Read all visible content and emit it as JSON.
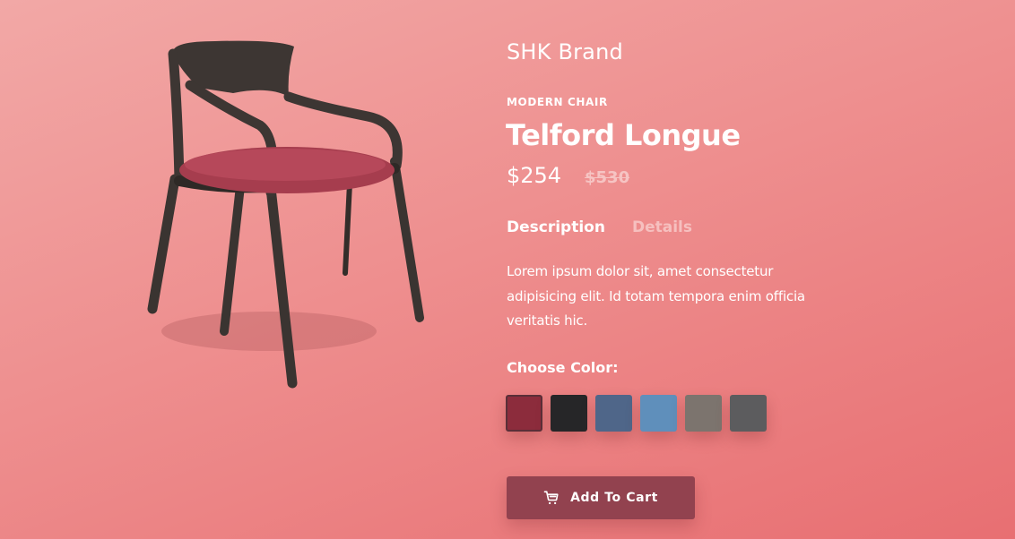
{
  "product": {
    "brand": "SHK Brand",
    "category": "MODERN CHAIR",
    "title": "Telford Longue",
    "price": "$254",
    "old_price": "$530"
  },
  "tabs": [
    {
      "label": "Description",
      "active": true
    },
    {
      "label": "Details",
      "active": false
    }
  ],
  "description": "Lorem ipsum dolor sit, amet consectetur adipisicing elit. Id totam tempora enim officia veritatis hic.",
  "colors": {
    "label": "Choose Color:",
    "options": [
      {
        "name": "burgundy-fabric",
        "hex": "#8c2c3c",
        "selected": true
      },
      {
        "name": "black-fabric",
        "hex": "#262628",
        "selected": false
      },
      {
        "name": "navy-velvet",
        "hex": "#4f6689",
        "selected": false
      },
      {
        "name": "light-blue-fabric",
        "hex": "#5f8fbb",
        "selected": false
      },
      {
        "name": "taupe-fabric",
        "hex": "#7c746e",
        "selected": false
      },
      {
        "name": "gray-fabric",
        "hex": "#5c5c5e",
        "selected": false
      }
    ]
  },
  "cart": {
    "label": "Add To Cart",
    "icon": "cart-icon"
  },
  "theme": {
    "accent": "#92424f",
    "background_top": "#f2a8a6",
    "background_bottom": "#e86f72"
  }
}
